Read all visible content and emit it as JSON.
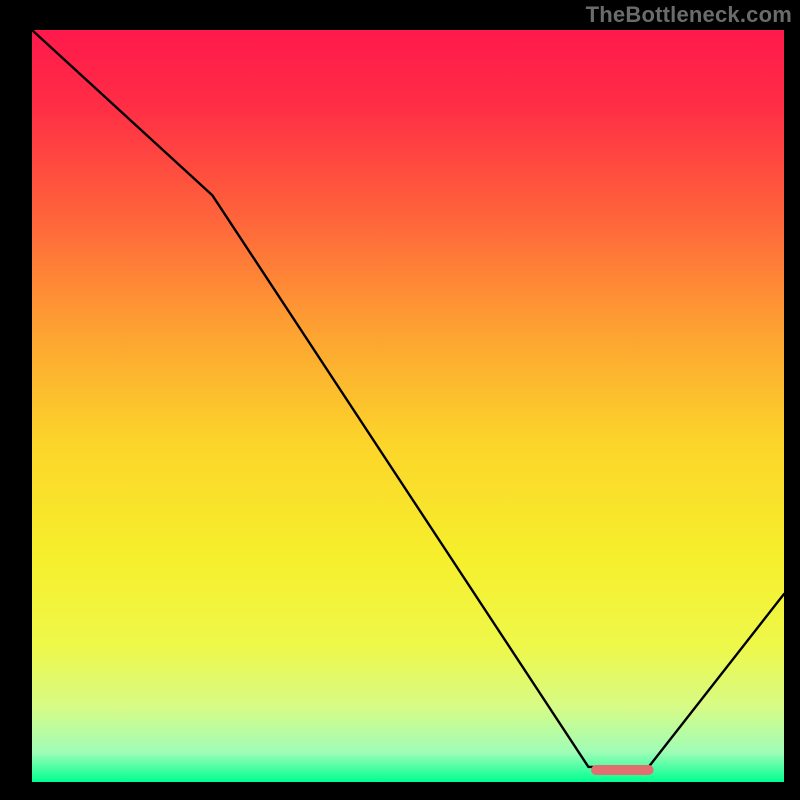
{
  "watermark": "TheBottleneck.com",
  "chart_data": {
    "type": "line",
    "title": "",
    "xlabel": "",
    "ylabel": "",
    "xlim": [
      0,
      100
    ],
    "ylim": [
      0,
      100
    ],
    "grid": false,
    "background_gradient": {
      "stops": [
        {
          "offset": 0.0,
          "color": "#ff194c"
        },
        {
          "offset": 0.1,
          "color": "#ff2d45"
        },
        {
          "offset": 0.25,
          "color": "#ff643b"
        },
        {
          "offset": 0.4,
          "color": "#fda232"
        },
        {
          "offset": 0.55,
          "color": "#fcd52a"
        },
        {
          "offset": 0.7,
          "color": "#f6ef2c"
        },
        {
          "offset": 0.82,
          "color": "#eef84a"
        },
        {
          "offset": 0.9,
          "color": "#d7fb86"
        },
        {
          "offset": 0.96,
          "color": "#a0fdb7"
        },
        {
          "offset": 1.0,
          "color": "#00ff91"
        }
      ]
    },
    "series": [
      {
        "name": "bottleneck-curve",
        "x": [
          0,
          24,
          74,
          82,
          100
        ],
        "y": [
          100,
          78,
          2,
          2,
          25
        ]
      }
    ],
    "marker": {
      "name": "optimal-segment",
      "x_start": 75,
      "x_end": 82,
      "y": 1.6,
      "color": "#e36e6f"
    }
  }
}
